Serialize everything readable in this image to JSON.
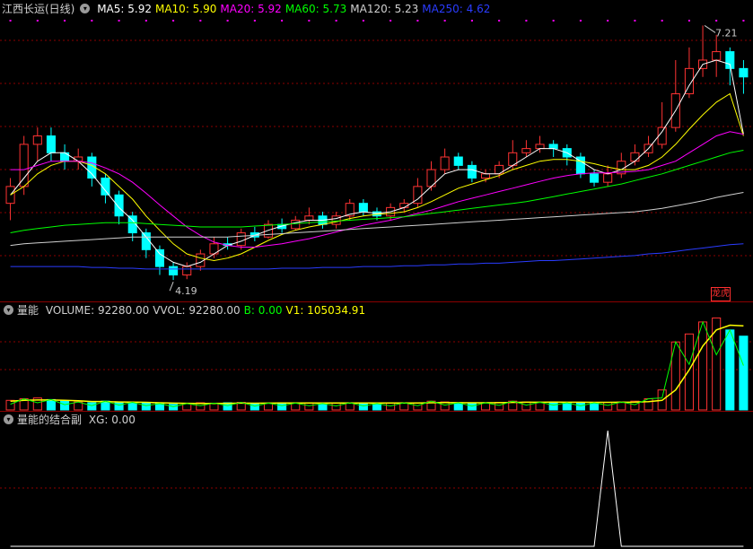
{
  "main_legend": {
    "title": "江西长运(日线)",
    "items": [
      {
        "label": "MA5: 5.92",
        "color": "#ffffff"
      },
      {
        "label": "MA10: 5.90",
        "color": "#ffff00"
      },
      {
        "label": "MA20: 5.92",
        "color": "#ff00ff"
      },
      {
        "label": "MA60: 5.73",
        "color": "#00ff00"
      },
      {
        "label": "MA120: 5.23",
        "color": "#d0d0d0"
      },
      {
        "label": "MA250: 4.62",
        "color": "#2a3cff"
      }
    ]
  },
  "annotations": {
    "high": "7.21",
    "low": "4.19",
    "badge": "龙虎"
  },
  "volume_legend": {
    "title": "量能",
    "items": [
      {
        "label": "VOLUME: 92280.00",
        "color": "#d0d0d0"
      },
      {
        "label": "VVOL: 92280.00",
        "color": "#d0d0d0"
      },
      {
        "label": "B: 0.00",
        "color": "#00ff00"
      },
      {
        "label": "V1: 105034.91",
        "color": "#ffff00"
      }
    ]
  },
  "indicator_legend": {
    "title": "量能的结合副",
    "items": [
      {
        "label": "XG: 0.00",
        "color": "#d0d0d0"
      }
    ]
  },
  "colors": {
    "up": "#ff3333",
    "down": "#00ffff",
    "grid": "#8b0000",
    "ma5": "#ffffff",
    "ma10": "#ffff00",
    "ma20": "#ff00ff",
    "ma60": "#00ff00",
    "ma120": "#d0d0d0",
    "ma250": "#2a3cff",
    "xg": "#ffffff"
  },
  "chart_data": [
    {
      "type": "candlestick",
      "title": "江西长运(日线)",
      "y_axis_range": [
        4.0,
        7.3
      ],
      "grid": true,
      "high_marker": 7.21,
      "low_marker": 4.19,
      "candles": [
        [
          5.1,
          5.3,
          5.4,
          4.9
        ],
        [
          5.3,
          5.8,
          5.9,
          5.2
        ],
        [
          5.8,
          5.9,
          6.0,
          5.6
        ],
        [
          5.9,
          5.7,
          6.0,
          5.6
        ],
        [
          5.7,
          5.6,
          5.8,
          5.5
        ],
        [
          5.6,
          5.65,
          5.75,
          5.5
        ],
        [
          5.65,
          5.4,
          5.7,
          5.3
        ],
        [
          5.4,
          5.2,
          5.45,
          5.1
        ],
        [
          5.2,
          4.95,
          5.25,
          4.85
        ],
        [
          4.95,
          4.75,
          5.0,
          4.65
        ],
        [
          4.75,
          4.55,
          4.8,
          4.45
        ],
        [
          4.55,
          4.35,
          4.6,
          4.25
        ],
        [
          4.35,
          4.25,
          4.4,
          4.19
        ],
        [
          4.25,
          4.35,
          4.4,
          4.2
        ],
        [
          4.35,
          4.5,
          4.55,
          4.3
        ],
        [
          4.5,
          4.62,
          4.7,
          4.45
        ],
        [
          4.62,
          4.6,
          4.7,
          4.55
        ],
        [
          4.6,
          4.75,
          4.8,
          4.55
        ],
        [
          4.75,
          4.7,
          4.82,
          4.65
        ],
        [
          4.7,
          4.85,
          4.9,
          4.68
        ],
        [
          4.85,
          4.8,
          4.92,
          4.75
        ],
        [
          4.8,
          4.9,
          4.95,
          4.78
        ],
        [
          4.9,
          4.95,
          5.05,
          4.85
        ],
        [
          4.95,
          4.85,
          5.0,
          4.8
        ],
        [
          4.85,
          4.95,
          5.0,
          4.8
        ],
        [
          4.95,
          5.1,
          5.15,
          4.9
        ],
        [
          5.1,
          5.0,
          5.15,
          4.95
        ],
        [
          5.0,
          4.95,
          5.05,
          4.9
        ],
        [
          4.95,
          5.05,
          5.1,
          4.9
        ],
        [
          5.05,
          5.1,
          5.15,
          5.0
        ],
        [
          5.1,
          5.3,
          5.4,
          5.05
        ],
        [
          5.3,
          5.5,
          5.6,
          5.25
        ],
        [
          5.5,
          5.65,
          5.75,
          5.45
        ],
        [
          5.65,
          5.55,
          5.7,
          5.5
        ],
        [
          5.55,
          5.4,
          5.6,
          5.35
        ],
        [
          5.4,
          5.45,
          5.5,
          5.35
        ],
        [
          5.45,
          5.55,
          5.6,
          5.4
        ],
        [
          5.55,
          5.7,
          5.85,
          5.5
        ],
        [
          5.7,
          5.75,
          5.85,
          5.65
        ],
        [
          5.75,
          5.8,
          5.9,
          5.7
        ],
        [
          5.8,
          5.75,
          5.85,
          5.65
        ],
        [
          5.75,
          5.65,
          5.8,
          5.55
        ],
        [
          5.65,
          5.45,
          5.7,
          5.4
        ],
        [
          5.45,
          5.35,
          5.5,
          5.3
        ],
        [
          5.35,
          5.45,
          5.55,
          5.3
        ],
        [
          5.45,
          5.6,
          5.7,
          5.4
        ],
        [
          5.6,
          5.7,
          5.8,
          5.55
        ],
        [
          5.7,
          5.8,
          5.9,
          5.65
        ],
        [
          5.8,
          6.0,
          6.3,
          5.75
        ],
        [
          6.0,
          6.4,
          6.8,
          5.95
        ],
        [
          6.4,
          6.7,
          6.95,
          6.35
        ],
        [
          6.7,
          6.8,
          7.21,
          6.6
        ],
        [
          6.8,
          6.9,
          7.1,
          6.6
        ],
        [
          6.9,
          6.7,
          6.95,
          6.5
        ],
        [
          6.7,
          6.6,
          6.8,
          6.4
        ]
      ]
    },
    {
      "type": "line",
      "name": "MA lines",
      "series": [
        {
          "name": "MA5",
          "values": [
            5.2,
            5.4,
            5.6,
            5.7,
            5.7,
            5.6,
            5.45,
            5.25,
            5.05,
            4.9,
            4.7,
            4.5,
            4.4,
            4.35,
            4.4,
            4.5,
            4.6,
            4.65,
            4.72,
            4.78,
            4.83,
            4.87,
            4.9,
            4.9,
            4.92,
            4.97,
            5.0,
            4.98,
            5.0,
            5.05,
            5.15,
            5.3,
            5.45,
            5.5,
            5.5,
            5.45,
            5.45,
            5.55,
            5.65,
            5.75,
            5.75,
            5.7,
            5.6,
            5.5,
            5.45,
            5.5,
            5.6,
            5.75,
            5.95,
            6.2,
            6.5,
            6.75,
            6.8,
            6.75,
            5.92
          ]
        },
        {
          "name": "MA10",
          "values": [
            5.2,
            5.3,
            5.45,
            5.55,
            5.6,
            5.6,
            5.55,
            5.45,
            5.3,
            5.15,
            4.95,
            4.78,
            4.62,
            4.5,
            4.45,
            4.42,
            4.45,
            4.5,
            4.58,
            4.66,
            4.73,
            4.78,
            4.82,
            4.85,
            4.88,
            4.92,
            4.95,
            4.97,
            4.98,
            5.0,
            5.05,
            5.12,
            5.2,
            5.28,
            5.33,
            5.38,
            5.43,
            5.5,
            5.55,
            5.6,
            5.62,
            5.62,
            5.6,
            5.57,
            5.53,
            5.5,
            5.5,
            5.55,
            5.65,
            5.8,
            5.98,
            6.15,
            6.3,
            6.4,
            5.9
          ]
        },
        {
          "name": "MA20",
          "values": [
            5.5,
            5.5,
            5.55,
            5.6,
            5.6,
            5.6,
            5.58,
            5.52,
            5.45,
            5.35,
            5.22,
            5.08,
            4.95,
            4.82,
            4.72,
            4.64,
            4.6,
            4.58,
            4.58,
            4.6,
            4.62,
            4.65,
            4.68,
            4.72,
            4.76,
            4.8,
            4.84,
            4.87,
            4.9,
            4.94,
            4.98,
            5.02,
            5.07,
            5.12,
            5.16,
            5.2,
            5.24,
            5.28,
            5.32,
            5.36,
            5.4,
            5.43,
            5.45,
            5.46,
            5.46,
            5.47,
            5.48,
            5.5,
            5.55,
            5.6,
            5.7,
            5.8,
            5.9,
            5.95,
            5.92
          ]
        },
        {
          "name": "MA60",
          "values": [
            4.75,
            4.78,
            4.8,
            4.82,
            4.84,
            4.85,
            4.86,
            4.87,
            4.87,
            4.87,
            4.86,
            4.85,
            4.84,
            4.83,
            4.82,
            4.82,
            4.82,
            4.82,
            4.83,
            4.84,
            4.85,
            4.86,
            4.87,
            4.88,
            4.89,
            4.9,
            4.91,
            4.92,
            4.93,
            4.94,
            4.96,
            4.98,
            5.0,
            5.02,
            5.04,
            5.06,
            5.08,
            5.1,
            5.12,
            5.15,
            5.18,
            5.21,
            5.24,
            5.27,
            5.3,
            5.33,
            5.37,
            5.41,
            5.45,
            5.5,
            5.55,
            5.6,
            5.65,
            5.7,
            5.73
          ]
        },
        {
          "name": "MA120",
          "values": [
            4.6,
            4.62,
            4.63,
            4.64,
            4.65,
            4.66,
            4.67,
            4.68,
            4.69,
            4.7,
            4.7,
            4.7,
            4.7,
            4.7,
            4.7,
            4.7,
            4.7,
            4.71,
            4.72,
            4.73,
            4.74,
            4.75,
            4.76,
            4.77,
            4.78,
            4.79,
            4.8,
            4.81,
            4.82,
            4.83,
            4.84,
            4.85,
            4.86,
            4.87,
            4.88,
            4.89,
            4.9,
            4.91,
            4.92,
            4.93,
            4.94,
            4.95,
            4.96,
            4.97,
            4.98,
            4.99,
            5.0,
            5.02,
            5.04,
            5.07,
            5.1,
            5.13,
            5.17,
            5.2,
            5.23
          ]
        },
        {
          "name": "MA250",
          "values": [
            4.35,
            4.35,
            4.35,
            4.35,
            4.35,
            4.35,
            4.34,
            4.34,
            4.33,
            4.33,
            4.32,
            4.32,
            4.32,
            4.32,
            4.32,
            4.32,
            4.32,
            4.32,
            4.32,
            4.32,
            4.33,
            4.33,
            4.33,
            4.34,
            4.34,
            4.34,
            4.35,
            4.35,
            4.35,
            4.36,
            4.36,
            4.37,
            4.37,
            4.38,
            4.38,
            4.39,
            4.39,
            4.4,
            4.41,
            4.42,
            4.42,
            4.43,
            4.44,
            4.45,
            4.46,
            4.47,
            4.48,
            4.5,
            4.51,
            4.53,
            4.55,
            4.57,
            4.59,
            4.61,
            4.62
          ]
        }
      ]
    },
    {
      "type": "bar",
      "name": "量能",
      "values": [
        12000,
        14000,
        15000,
        13000,
        11000,
        10000,
        9000,
        11000,
        10000,
        9500,
        9000,
        8000,
        7000,
        8000,
        9000,
        8500,
        9000,
        9500,
        8000,
        8500,
        9000,
        8500,
        9000,
        8000,
        8500,
        9000,
        8500,
        8000,
        8500,
        9000,
        9000,
        11000,
        10000,
        9000,
        8000,
        9000,
        9500,
        11000,
        10000,
        9500,
        10000,
        9000,
        8500,
        9000,
        9500,
        10000,
        11000,
        14000,
        25000,
        85000,
        95000,
        110000,
        115000,
        100000,
        92280
      ],
      "series": [
        {
          "name": "V1",
          "values": [
            11000,
            12000,
            12500,
            12500,
            12000,
            11500,
            10500,
            10500,
            10000,
            9800,
            9500,
            9000,
            8500,
            8300,
            8200,
            8200,
            8300,
            8500,
            8400,
            8500,
            8600,
            8600,
            8700,
            8600,
            8600,
            8700,
            8700,
            8600,
            8600,
            8700,
            8700,
            9000,
            9200,
            9100,
            9000,
            9000,
            9100,
            9400,
            9600,
            9700,
            9800,
            9700,
            9600,
            9500,
            9500,
            9600,
            9800,
            10400,
            12000,
            25000,
            50000,
            80000,
            100000,
            106000,
            105034.91
          ]
        }
      ],
      "y_axis_range": [
        0,
        120000
      ]
    },
    {
      "type": "line",
      "name": "XG",
      "x_positions": "single spike near right-center",
      "values": [
        0,
        0,
        0,
        0,
        0,
        0,
        0,
        0,
        0,
        0,
        0,
        0,
        0,
        0,
        0,
        0,
        0,
        0,
        0,
        0,
        0,
        0,
        0,
        0,
        0,
        0,
        0,
        0,
        0,
        0,
        0,
        0,
        0,
        0,
        0,
        0,
        0,
        0,
        0,
        0,
        0,
        0,
        0,
        0,
        1,
        0,
        0,
        0,
        0,
        0,
        0,
        0,
        0,
        0,
        0
      ],
      "y_axis_range": [
        0,
        1
      ]
    }
  ]
}
